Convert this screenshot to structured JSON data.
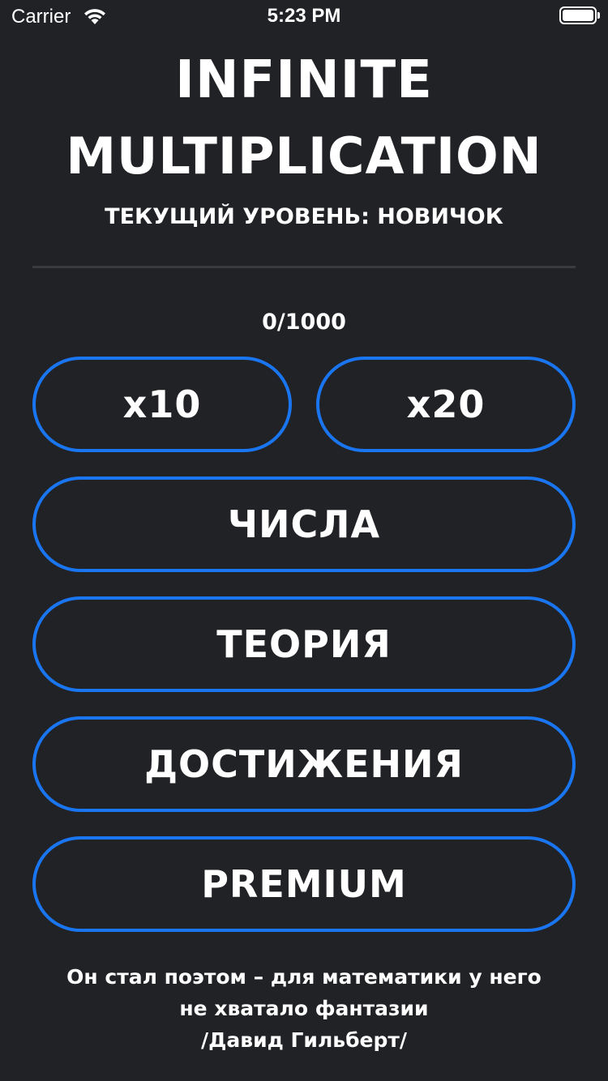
{
  "status_bar": {
    "carrier": "Carrier",
    "time": "5:23 PM",
    "wifi_icon": "wifi-icon",
    "battery_icon": "battery-icon"
  },
  "header": {
    "title_line1": "INFINITE",
    "title_line2": "MULTIPLICATION",
    "current_level": "ТЕКУЩИЙ УРОВЕНЬ: НОВИЧОК"
  },
  "progress": {
    "text": "0/1000",
    "current": 0,
    "total": 1000
  },
  "buttons": {
    "x10": "x10",
    "x20": "x20",
    "numbers": "ЧИСЛА",
    "theory": "ТЕОРИЯ",
    "achievements": "ДОСТИЖЕНИЯ",
    "premium": "PREMIUM"
  },
  "quote": {
    "line1": "Он стал поэтом – для математики у него",
    "line2": "не хватало фантазии",
    "author": "/Давид Гильберт/"
  },
  "colors": {
    "background": "#212226",
    "accent": "#1a75f0",
    "text": "#ffffff",
    "divider": "#3a3b3f"
  }
}
